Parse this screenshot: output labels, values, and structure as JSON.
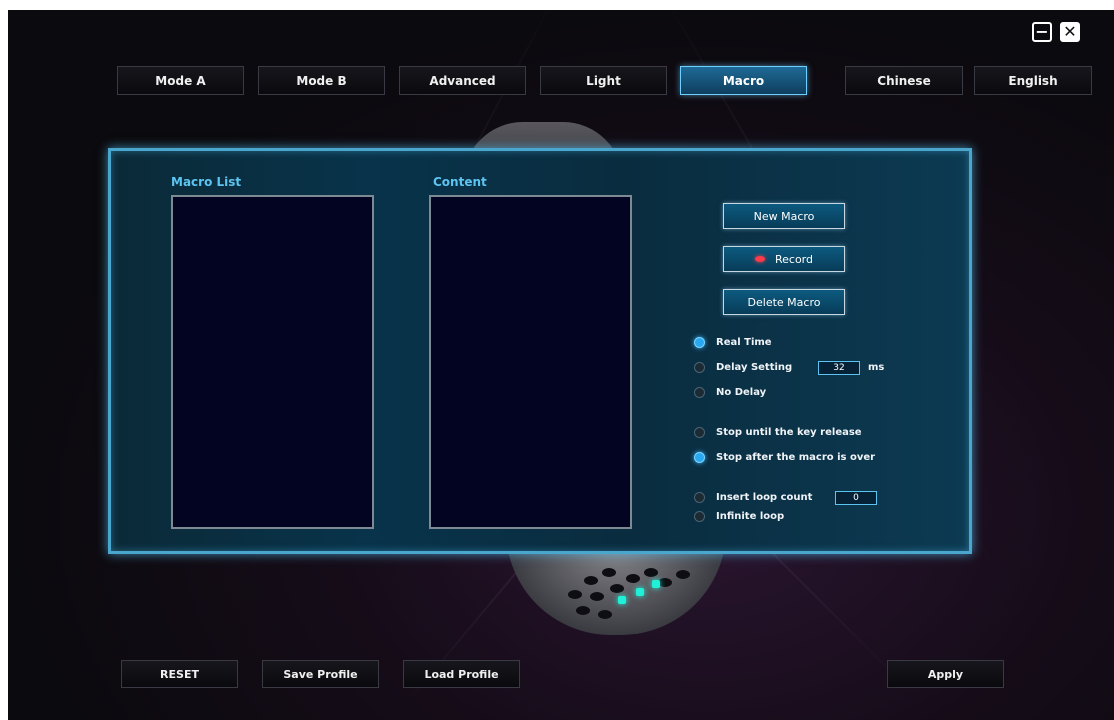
{
  "window": {
    "minimize_glyph": "−",
    "close_glyph": "✕"
  },
  "tabs": [
    {
      "label": "Mode A"
    },
    {
      "label": "Mode B"
    },
    {
      "label": "Advanced"
    },
    {
      "label": "Light"
    },
    {
      "label": "Macro",
      "active": true
    },
    {
      "label": "Chinese"
    },
    {
      "label": "English"
    }
  ],
  "macro": {
    "macro_list_title": "Macro List",
    "content_title": "Content",
    "new_macro_label": "New Macro",
    "record_label": "Record",
    "delete_macro_label": "Delete Macro",
    "delay_options": {
      "real_time": "Real Time",
      "delay_setting": "Delay Setting",
      "delay_value": "32",
      "delay_unit": "ms",
      "no_delay": "No Delay",
      "selected": "Real Time"
    },
    "stop_options": {
      "until_release": "Stop until the key release",
      "after_macro": "Stop after the macro is over",
      "selected": "Stop after the macro is over"
    },
    "loop_options": {
      "insert_loop": "Insert loop count",
      "loop_value": "0",
      "infinite": "Infinite loop"
    }
  },
  "bottom": {
    "reset_label": "RESET",
    "save_label": "Save Profile",
    "load_label": "Load Profile",
    "apply_label": "Apply"
  },
  "colors": {
    "accent": "#5cc4f0",
    "active_tab": "#1e6a96",
    "record": "#ff3a4a"
  }
}
